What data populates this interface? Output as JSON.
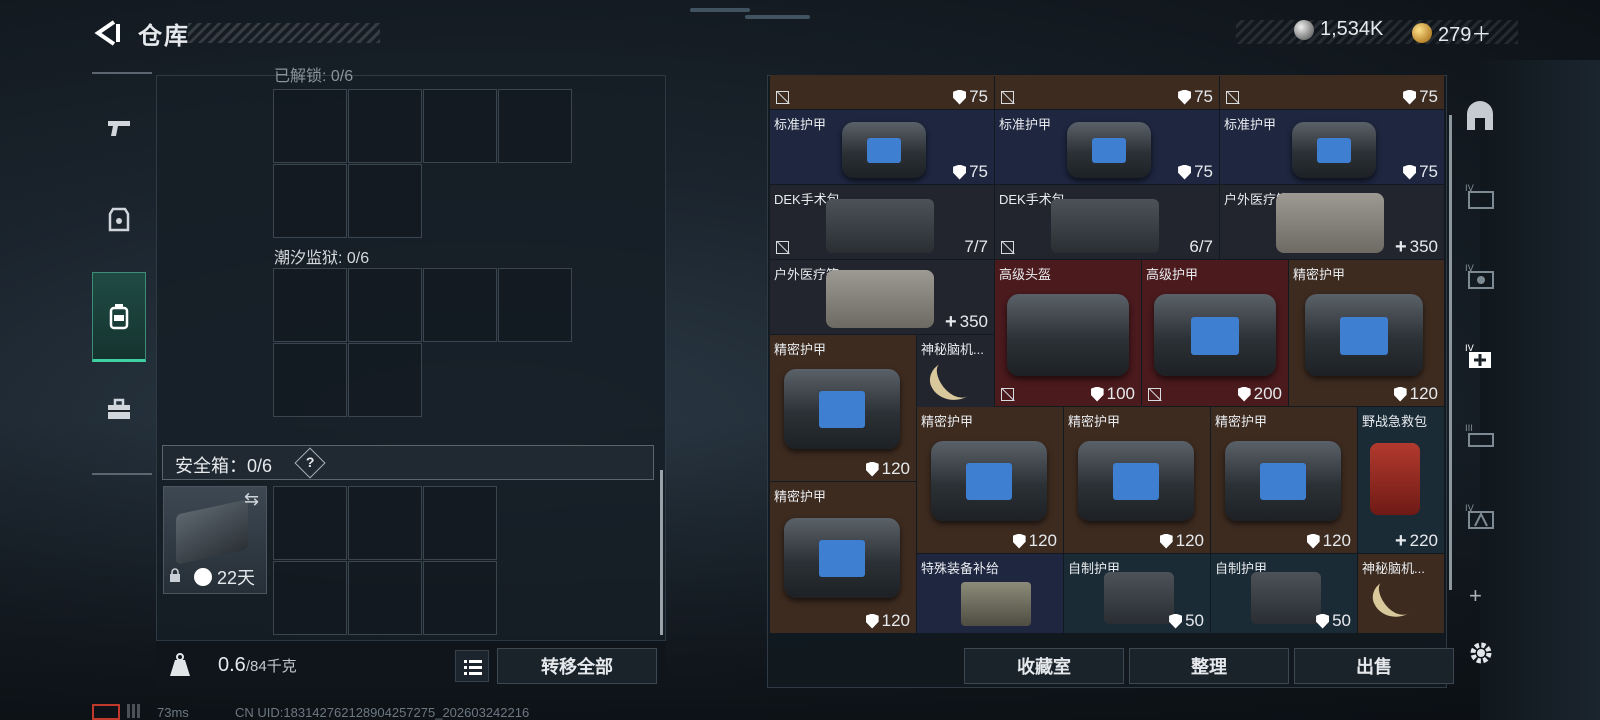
{
  "header": {
    "title": "仓库"
  },
  "currency": {
    "silver": "1,534K",
    "gold": "279＋"
  },
  "left_tabs": [
    {
      "name": "weapon-tab",
      "icon": "pistol-icon"
    },
    {
      "name": "armor-tab",
      "icon": "vest-icon"
    },
    {
      "name": "backpack-tab",
      "icon": "backpack-icon",
      "active": true
    },
    {
      "name": "toolbox-tab",
      "icon": "toolbox-icon"
    }
  ],
  "left_panel": {
    "top_label": "已解锁: 0/6",
    "tidal_label": "潮汐监狱: 0/6",
    "safe_label": "安全箱：0/6",
    "help": "?",
    "safe_days": "22天",
    "weight_value": "0.6",
    "weight_cap": "/84千克",
    "transfer_all": "转移全部"
  },
  "inventory": {
    "top_row_values": [
      "75",
      "75",
      "75"
    ],
    "items": [
      {
        "name": "标准护甲",
        "value": "75"
      },
      {
        "name": "标准护甲",
        "value": "75"
      },
      {
        "name": "标准护甲",
        "value": "75"
      },
      {
        "name": "DEK手术包",
        "value": "7/7"
      },
      {
        "name": "DEK手术包",
        "value": "6/7"
      },
      {
        "name": "户外医疗箱",
        "value": "350"
      },
      {
        "name": "户外医疗箱",
        "value": "350"
      },
      {
        "name": "高级头盔",
        "value": "100"
      },
      {
        "name": "高级护甲",
        "value": "200"
      },
      {
        "name": "精密护甲",
        "value": "120"
      },
      {
        "name": "精密护甲",
        "value": "120"
      },
      {
        "name": "神秘脑机...",
        "value": ""
      },
      {
        "name": "精密护甲",
        "value": "120"
      },
      {
        "name": "精密护甲",
        "value": "120"
      },
      {
        "name": "精密护甲",
        "value": "120"
      },
      {
        "name": "野战急救包",
        "value": "220"
      },
      {
        "name": "精密护甲",
        "value": "120"
      },
      {
        "name": "特殊装备补给",
        "value": ""
      },
      {
        "name": "自制护甲",
        "value": "50"
      },
      {
        "name": "自制护甲",
        "value": "50"
      },
      {
        "name": "神秘脑机...",
        "value": ""
      }
    ]
  },
  "bottom_buttons": {
    "collection": "收藏室",
    "sort": "整理",
    "sell": "出售"
  },
  "footer": {
    "ping": "73ms",
    "uid": "CN UID:18314276212890425727​5_202603242216"
  }
}
